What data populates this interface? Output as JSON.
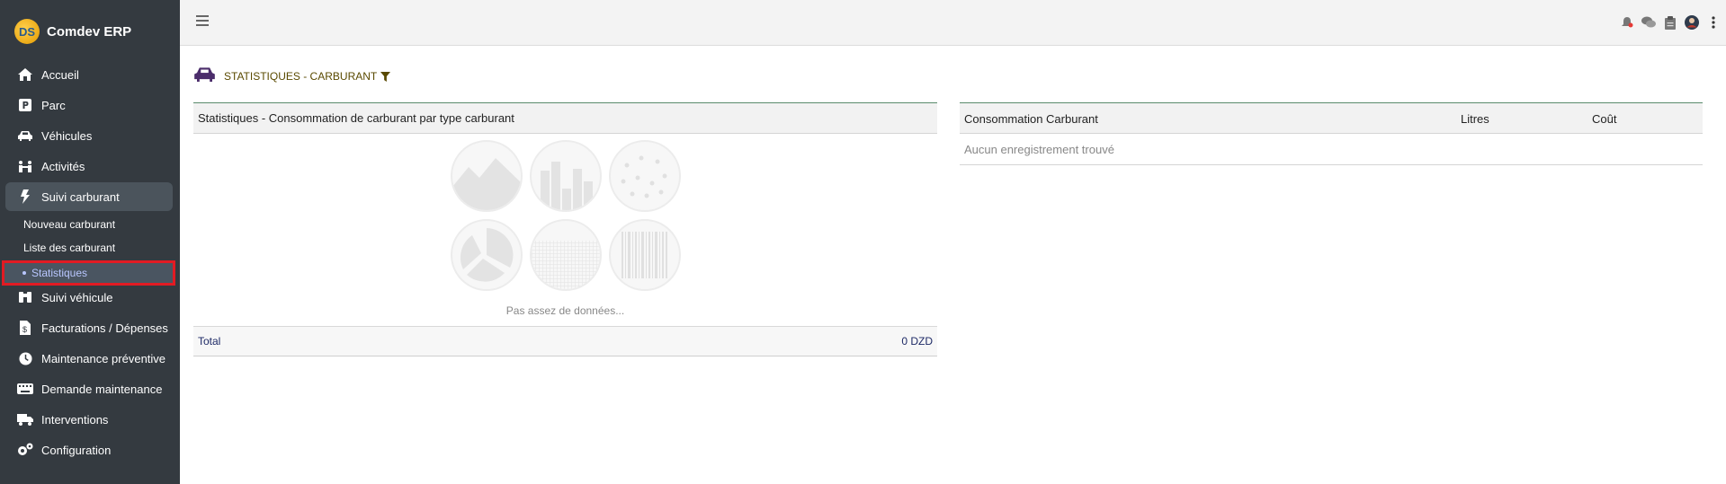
{
  "app": {
    "name": "Comdev ERP",
    "logo_text": "DS"
  },
  "sidebar": {
    "items": [
      {
        "label": "Accueil",
        "icon": "home-icon"
      },
      {
        "label": "Parc",
        "icon": "parking-icon"
      },
      {
        "label": "Véhicules",
        "icon": "car-icon"
      },
      {
        "label": "Activités",
        "icon": "activities-icon"
      },
      {
        "label": "Suivi carburant",
        "icon": "bolt-icon"
      },
      {
        "label": "Suivi véhicule",
        "icon": "binoculars-icon"
      },
      {
        "label": "Facturations / Dépenses",
        "icon": "invoice-icon"
      },
      {
        "label": "Maintenance préventive",
        "icon": "clock-icon"
      },
      {
        "label": "Demande maintenance",
        "icon": "keyboard-icon"
      },
      {
        "label": "Interventions",
        "icon": "truck-icon"
      },
      {
        "label": "Configuration",
        "icon": "cogs-icon"
      }
    ],
    "submenu": [
      "Nouveau carburant",
      "Liste des carburant",
      "Statistiques"
    ]
  },
  "topbar": {
    "icons": [
      "bell-icon",
      "chat-icon",
      "clipboard-icon",
      "user-avatar",
      "more-vertical-icon"
    ]
  },
  "page": {
    "title": "STATISTIQUES - CARBURANT",
    "icon": "car-icon",
    "filter_icon": "filter-icon"
  },
  "left_panel": {
    "title": "Statistiques - Consommation de carburant par type carburant",
    "no_data": "Pas assez de données...",
    "total_label": "Total",
    "total_value": "0 DZD"
  },
  "right_table": {
    "columns": [
      "Consommation Carburant",
      "Litres",
      "Coût"
    ],
    "empty": "Aucun enregistrement trouvé"
  },
  "colors": {
    "sidebar_bg": "#343a40",
    "highlight_border": "#e21b23",
    "accent_green": "#5a8b6d"
  }
}
